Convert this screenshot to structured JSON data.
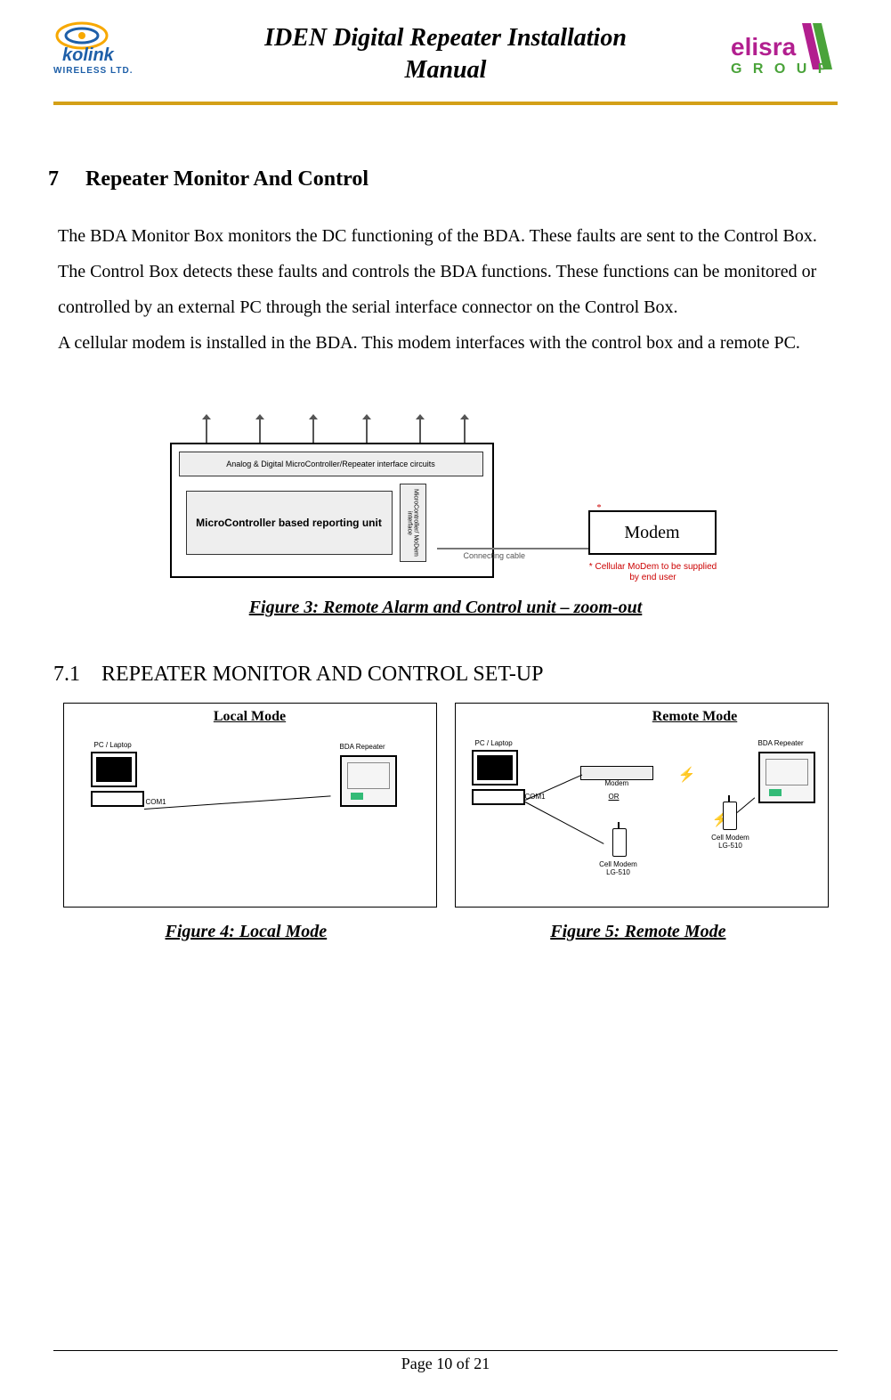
{
  "header": {
    "title_line1": "IDEN Digital Repeater Installation",
    "title_line2": "Manual",
    "logo_left_top": "kolink",
    "logo_left_sub": "WIRELESS LTD.",
    "logo_right_top": "elisra",
    "logo_right_sub": "G R O U P"
  },
  "section7": {
    "number": "7",
    "title": "Repeater Monitor And Control",
    "para": "The BDA Monitor Box monitors the DC functioning of the BDA. These faults are sent to the Control Box. The Control Box detects these faults and controls the BDA functions. These functions can be monitored or controlled by an external PC through the serial interface connector on the Control Box.",
    "para2": "A cellular modem is installed in the BDA.  This modem interfaces with the control box and a remote PC."
  },
  "figure3": {
    "strip": "Analog & Digital MicroController/Repeater interface circuits",
    "reporting": "MicroController based reporting unit",
    "iface": "MicroController/ MoDem interface",
    "cable": "Connecting cable",
    "modem": "Modem",
    "note": "* Cellular MoDem to be supplied by end user",
    "caption": "Figure 3: Remote Alarm and Control unit – zoom-out"
  },
  "section71": {
    "number": "7.1",
    "title": "REPEATER MONITOR AND CONTROL SET-UP"
  },
  "figure4": {
    "title": "Local  Mode",
    "pc_label": "PC / Laptop",
    "com": "COM1",
    "bda": "BDA Repeater",
    "caption": "Figure 4: Local Mode "
  },
  "figure5": {
    "title": "Remote Mode",
    "pc_label": "PC / Laptop",
    "com": "COM1",
    "modem": "Modem",
    "or": "OR",
    "cell1": "Cell Modem LG-510",
    "cell2": "Cell Modem LG-510",
    "bda": "BDA Repeater",
    "caption": "Figure 5: Remote Mode"
  },
  "footer": {
    "text": "Page 10 of 21"
  }
}
